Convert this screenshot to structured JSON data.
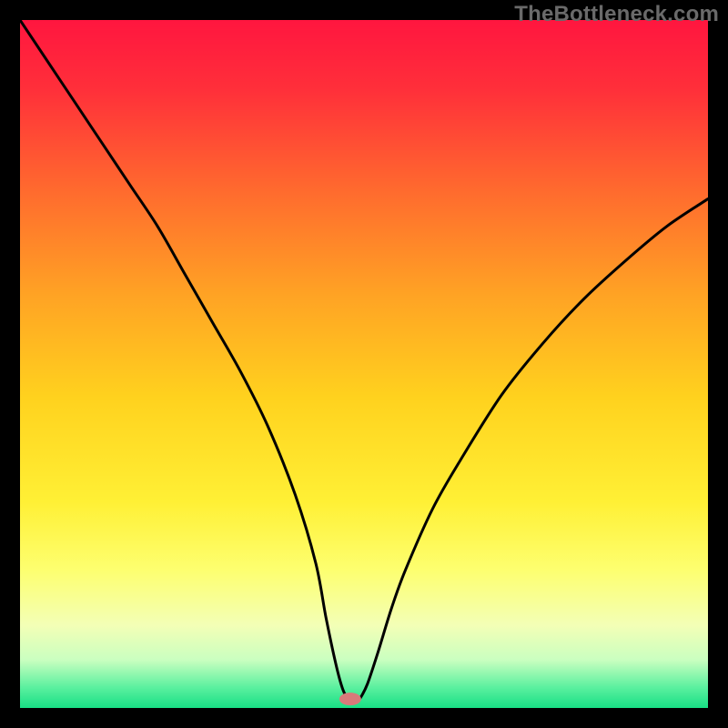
{
  "watermark": "TheBottleneck.com",
  "chart_data": {
    "type": "line",
    "title": "",
    "xlabel": "",
    "ylabel": "",
    "xlim": [
      0,
      100
    ],
    "ylim": [
      0,
      100
    ],
    "grid": false,
    "legend": false,
    "background": {
      "type": "vertical-gradient",
      "stops": [
        {
          "y_pct": 0,
          "color": "#ff163f"
        },
        {
          "y_pct": 10,
          "color": "#ff2f3a"
        },
        {
          "y_pct": 25,
          "color": "#ff6b2e"
        },
        {
          "y_pct": 40,
          "color": "#ffa324"
        },
        {
          "y_pct": 55,
          "color": "#ffd21e"
        },
        {
          "y_pct": 70,
          "color": "#fff035"
        },
        {
          "y_pct": 80,
          "color": "#fdff70"
        },
        {
          "y_pct": 88,
          "color": "#f3ffb6"
        },
        {
          "y_pct": 93,
          "color": "#caffc0"
        },
        {
          "y_pct": 97,
          "color": "#5bf09f"
        },
        {
          "y_pct": 100,
          "color": "#18df85"
        }
      ]
    },
    "series": [
      {
        "name": "bottleneck-curve",
        "color": "#000000",
        "stroke_width": 3,
        "x": [
          0,
          4,
          8,
          12,
          16,
          20,
          24,
          28,
          32,
          36,
          40,
          43,
          44.5,
          46,
          47,
          48,
          49,
          49.5,
          50.5,
          52,
          54,
          56,
          60,
          64,
          70,
          76,
          82,
          88,
          94,
          100
        ],
        "y": [
          100,
          94,
          88,
          82,
          76,
          70,
          63,
          56,
          49,
          41,
          31,
          21,
          13,
          6,
          2.5,
          1,
          1,
          1.5,
          3.5,
          8,
          14.5,
          20,
          29,
          36,
          45.5,
          53,
          59.5,
          65,
          70,
          74
        ]
      }
    ],
    "marker": {
      "name": "optimal-point",
      "x_pct": 48,
      "y_pct": 1.3,
      "color": "#d87a7a",
      "rx": 12,
      "ry": 7
    }
  }
}
